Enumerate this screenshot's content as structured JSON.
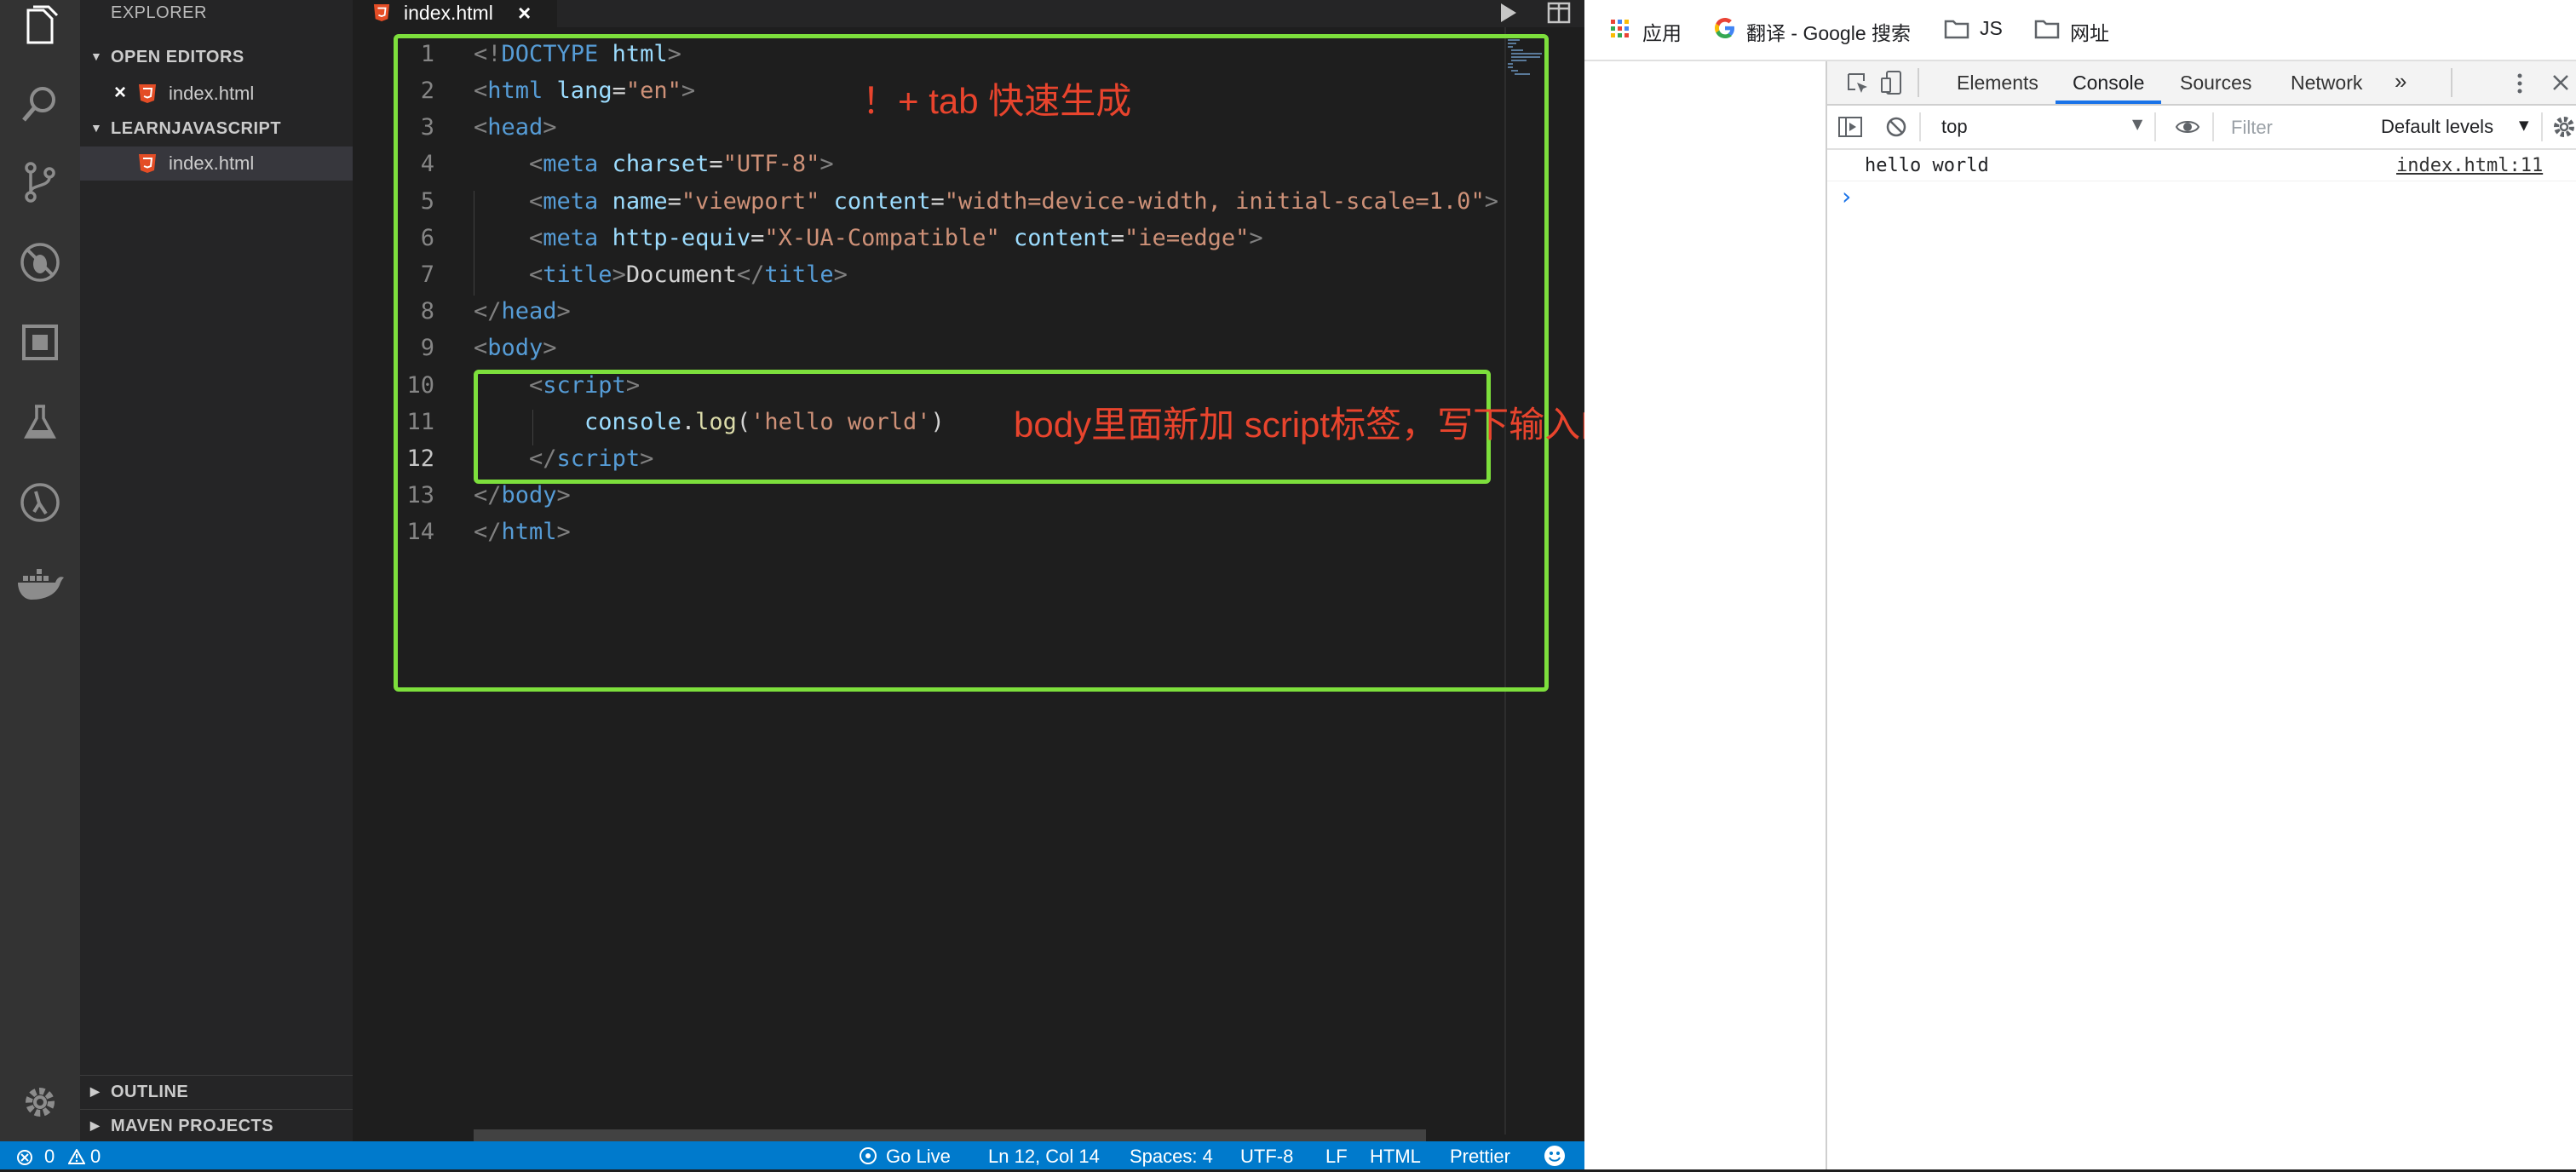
{
  "sidebar": {
    "header": "EXPLORER",
    "open_editors_label": "OPEN EDITORS",
    "open_file": "index.html",
    "project_label": "LEARNJAVASCRIPT",
    "project_file": "index.html",
    "outline_label": "OUTLINE",
    "maven_label": "MAVEN PROJECTS"
  },
  "editor": {
    "tab_label": "index.html",
    "tab_close": "×",
    "line_numbers": [
      "1",
      "2",
      "3",
      "4",
      "5",
      "6",
      "7",
      "8",
      "9",
      "10",
      "11",
      "12",
      "13",
      "14"
    ],
    "current_line": 12
  },
  "status": {
    "errors": "0",
    "warnings": "0",
    "go_live": "Go Live",
    "position": "Ln 12, Col 14",
    "spaces": "Spaces: 4",
    "encoding": "UTF-8",
    "eol": "LF",
    "language": "HTML",
    "formatter": "Prettier"
  },
  "annotations": {
    "tip_top": "！+ tab 快速生成",
    "tip_body": "body里面新加 script标签，写下输入的语句，保存以后，浏览器控制台里面看效果即可"
  },
  "bookmarks": {
    "apps": "应用",
    "google": "翻译 - Google 搜索",
    "js": "JS",
    "sites": "网址"
  },
  "devtools": {
    "tabs": [
      "Elements",
      "Console",
      "Sources",
      "Network"
    ],
    "active_tab": "Console",
    "more": "»",
    "context": "top",
    "filter_placeholder": "Filter",
    "levels": "Default levels",
    "log_message": "hello world",
    "log_source": "index.html:11",
    "prompt": "›"
  },
  "colors": {
    "accent_green": "#7ddf3c",
    "annotation_red": "#e8442d",
    "status_blue": "#007acc",
    "devtools_active": "#1a73e8"
  }
}
